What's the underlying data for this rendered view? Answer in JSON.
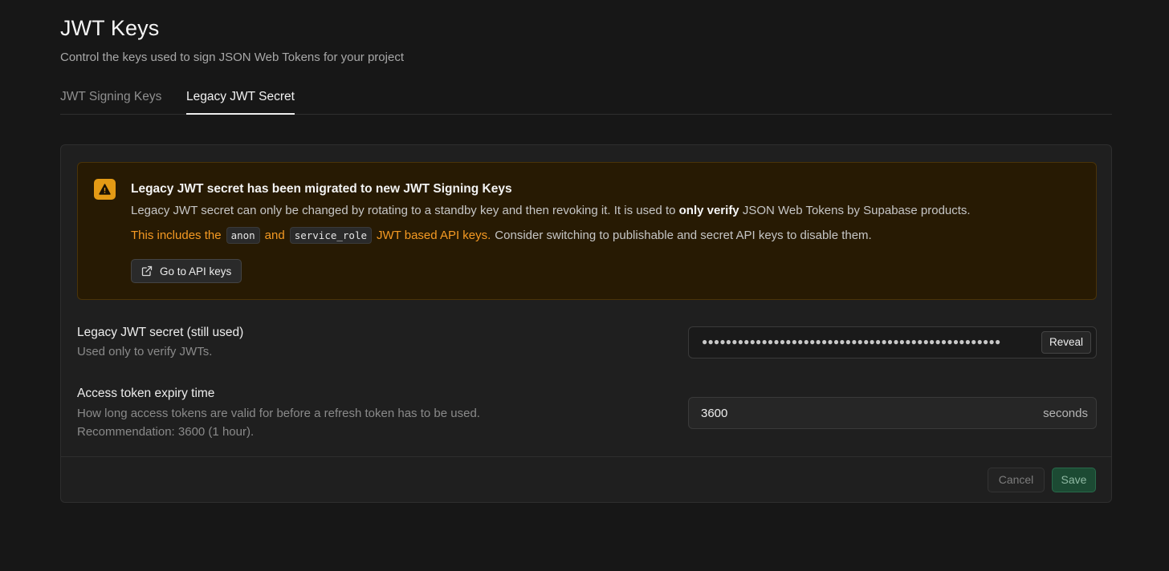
{
  "header": {
    "title": "JWT Keys",
    "subtitle": "Control the keys used to sign JSON Web Tokens for your project"
  },
  "tabs": [
    {
      "label": "JWT Signing Keys",
      "active": false
    },
    {
      "label": "Legacy JWT Secret",
      "active": true
    }
  ],
  "alert": {
    "icon": "warning-icon",
    "accent_color": "#e39a15",
    "title": "Legacy JWT secret has been migrated to new JWT Signing Keys",
    "line1_a": "Legacy JWT secret can only be changed by rotating to a standby key and then revoking it. It is used to ",
    "line1_bold": "only verify",
    "line1_b": " JSON Web Tokens by Supabase products.",
    "line2_a": "This includes the",
    "code1": "anon",
    "line2_and": "and",
    "code2": "service_role",
    "line2_b": "JWT based API keys.",
    "line2_c": "Consider switching to publishable and secret API keys to disable them.",
    "button_label": "Go to API keys",
    "button_icon": "external-link-icon"
  },
  "secret": {
    "label": "Legacy JWT secret (still used)",
    "description": "Used only to verify JWTs.",
    "masked_value": "●●●●●●●●●●●●●●●●●●●●●●●●●●●●●●●●●●●●●●●●●●●●●●●●●●",
    "reveal_label": "Reveal"
  },
  "expiry": {
    "label": "Access token expiry time",
    "description_1": "How long access tokens are valid for before a refresh token has to be used.",
    "description_2": "Recommendation: 3600 (1 hour).",
    "value": "3600",
    "suffix": "seconds"
  },
  "footer": {
    "cancel_label": "Cancel",
    "save_label": "Save",
    "save_color": "#1c4a33"
  }
}
